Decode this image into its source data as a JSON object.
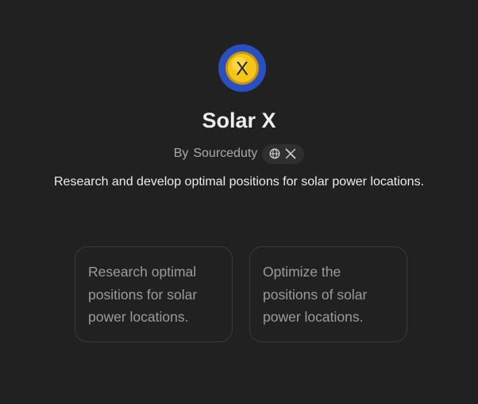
{
  "gpt": {
    "name": "Solar X",
    "by_prefix": "By",
    "author": "Sourceduty",
    "description": "Research and develop optimal positions for solar power locations.",
    "avatar_letter": "X",
    "avatar_colors": {
      "ring": "#2a4fbf",
      "sun": "#f5c518",
      "letter": "#222222"
    }
  },
  "links": {
    "website_icon": "globe-icon",
    "x_icon": "x-logo-icon"
  },
  "conversation_starters": [
    {
      "text": "Research optimal positions for solar power locations."
    },
    {
      "text": "Optimize the positions of solar power locations."
    }
  ]
}
